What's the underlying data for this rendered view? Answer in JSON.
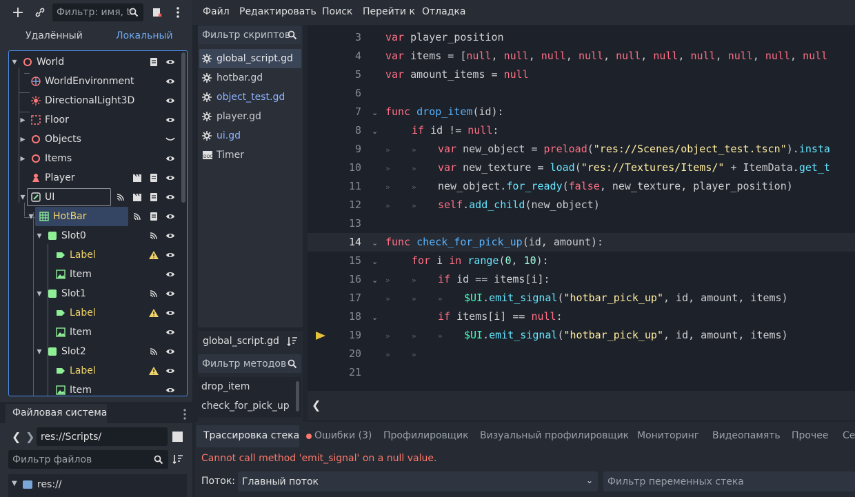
{
  "scene_toolbar": {
    "add_icon": "plus-icon",
    "link_icon": "link-icon",
    "filter_placeholder": "Фильтр: имя, t:",
    "search_icon": "search-icon",
    "script_icon": "script-icon",
    "menu_icon": "kebab-icon"
  },
  "scene_tabs": {
    "remote": "Удалённый",
    "local": "Локальный"
  },
  "tree": [
    {
      "label": "World",
      "depth": 0,
      "arrow": "down",
      "icon": "node-circle-icon"
    },
    {
      "label": "WorldEnvironment",
      "depth": 1,
      "icon": "globe-icon"
    },
    {
      "label": "DirectionalLight3D",
      "depth": 1,
      "icon": "sun-icon"
    },
    {
      "label": "Floor",
      "depth": 1,
      "arrow": "right",
      "icon": "meshes-icon"
    },
    {
      "label": "Objects",
      "depth": 1,
      "arrow": "right",
      "icon": "node-circle-icon"
    },
    {
      "label": "Items",
      "depth": 1,
      "arrow": "right",
      "icon": "node-circle-icon"
    },
    {
      "label": "Player",
      "depth": 1,
      "icon": "player-icon"
    },
    {
      "label": "UI",
      "depth": 1,
      "arrow": "down",
      "icon": "control-icon"
    },
    {
      "label": "HotBar",
      "depth": 2,
      "arrow": "down",
      "icon": "grid-icon"
    },
    {
      "label": "Slot0",
      "depth": 3,
      "arrow": "down",
      "icon": "panel-icon"
    },
    {
      "label": "Label",
      "depth": 4,
      "icon": "label-icon"
    },
    {
      "label": "Item",
      "depth": 4,
      "icon": "texture-icon"
    },
    {
      "label": "Slot1",
      "depth": 3,
      "arrow": "down",
      "icon": "panel-icon"
    },
    {
      "label": "Label",
      "depth": 4,
      "icon": "label-icon"
    },
    {
      "label": "Item",
      "depth": 4,
      "icon": "texture-icon"
    },
    {
      "label": "Slot2",
      "depth": 3,
      "arrow": "down",
      "icon": "panel-icon"
    },
    {
      "label": "Label",
      "depth": 4,
      "icon": "label-icon"
    },
    {
      "label": "Item",
      "depth": 4,
      "icon": "texture-icon"
    }
  ],
  "filesystem": {
    "title": "Файловая система",
    "path": "res://Scripts/",
    "filter_placeholder": "Фильтр файлов",
    "root": "res://"
  },
  "menu": [
    "Файл",
    "Редактировать",
    "Поиск",
    "Перейти к",
    "Отладка"
  ],
  "scripts": {
    "filter_placeholder": "Фильтр скриптов",
    "items": [
      "global_script.gd",
      "hotbar.gd",
      "object_test.gd",
      "player.gd",
      "ui.gd",
      "Timer"
    ],
    "current": "global_script.gd",
    "methods_placeholder": "Фильтр методов",
    "methods": [
      "drop_item",
      "check_for_pick_up"
    ]
  },
  "code": {
    "line_numbers": [
      "3",
      "4",
      "5",
      "6",
      "7",
      "8",
      "9",
      "10",
      "11",
      "12",
      "13",
      "14",
      "15",
      "16",
      "17",
      "18",
      "19",
      "20",
      "21"
    ]
  },
  "bottom": {
    "tabs": [
      "Трассировка стека",
      "Ошибки (3)",
      "Профилировщик",
      "Визуальный профилировщик",
      "Мониторинг",
      "Видеопамять",
      "Прочее",
      "Сет"
    ],
    "error": "Cannot call method 'emit_signal' on a null value.",
    "thread_label": "Поток:",
    "thread_value": "Главный поток",
    "var_filter": "Фильтр переменных стека"
  },
  "colors": {
    "accent": "#4d8ce6",
    "error": "#ff786b",
    "keyword": "#ff7085",
    "string": "#ffeda1",
    "warning": "#f0d36a"
  }
}
